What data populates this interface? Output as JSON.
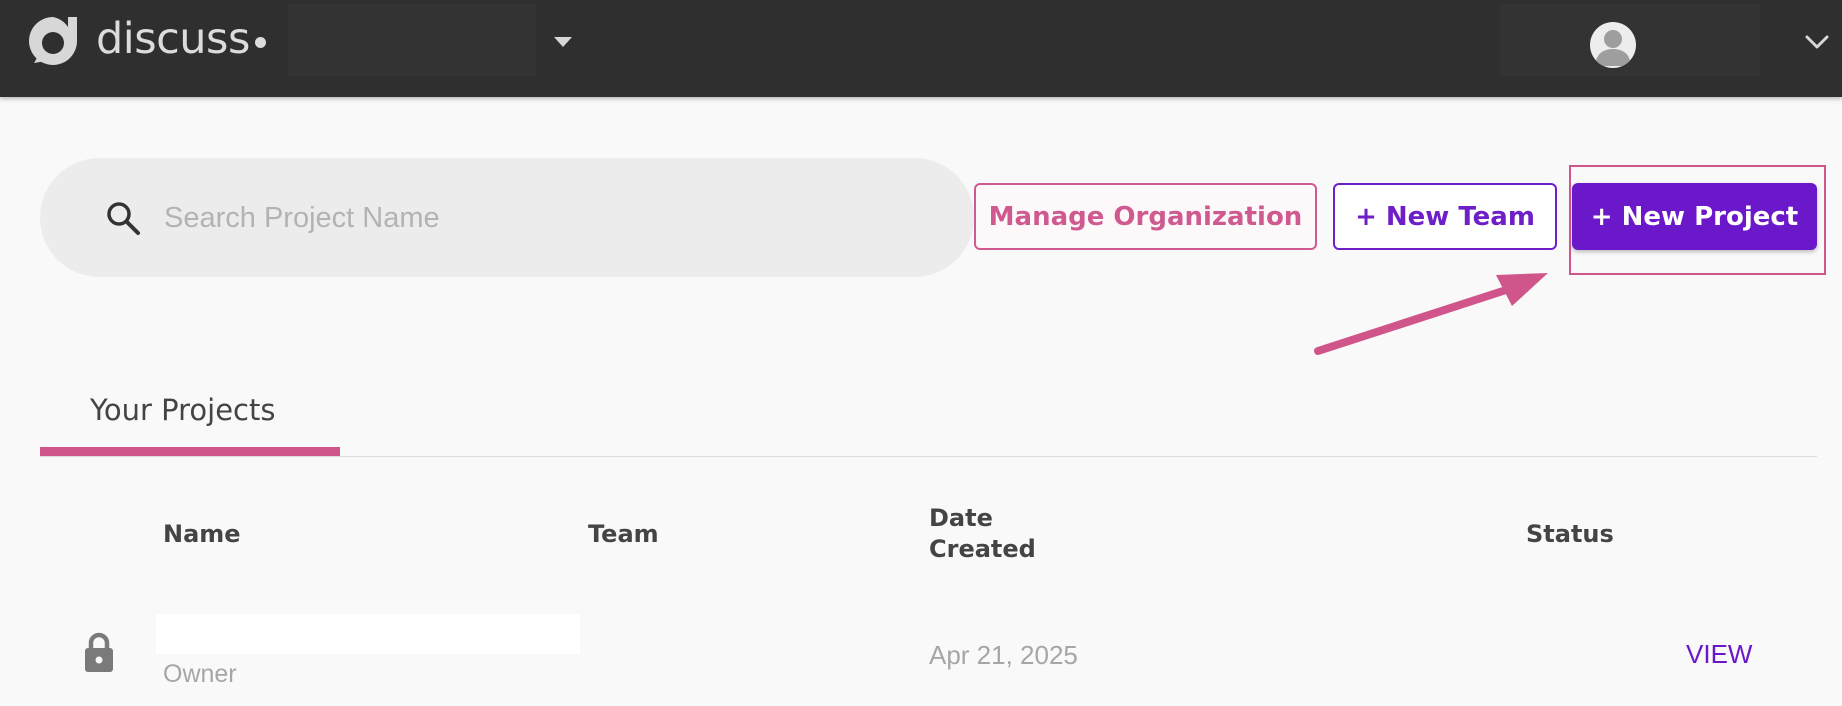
{
  "app": {
    "logo_text": "discuss"
  },
  "search": {
    "placeholder": "Search Project Name",
    "value": ""
  },
  "actions": {
    "manage_org_label": "Manage Organization",
    "new_team_label": "+ New Team",
    "new_project_label": "+ New Project"
  },
  "tabs": [
    {
      "label": "Your Projects",
      "active": true
    }
  ],
  "table": {
    "columns": {
      "name": "Name",
      "team": "Team",
      "date_created_line1": "Date",
      "date_created_line2": "Created",
      "status": "Status"
    },
    "rows": [
      {
        "name": "",
        "role": "Owner",
        "team": "",
        "date_created": "Apr 21, 2025",
        "action": "VIEW",
        "icon": "lock-icon"
      }
    ]
  },
  "colors": {
    "topbar": "#2f2f2f",
    "accent_pink": "#d0558b",
    "accent_purple": "#6a18c9",
    "page_bg": "#f9f9f9"
  }
}
